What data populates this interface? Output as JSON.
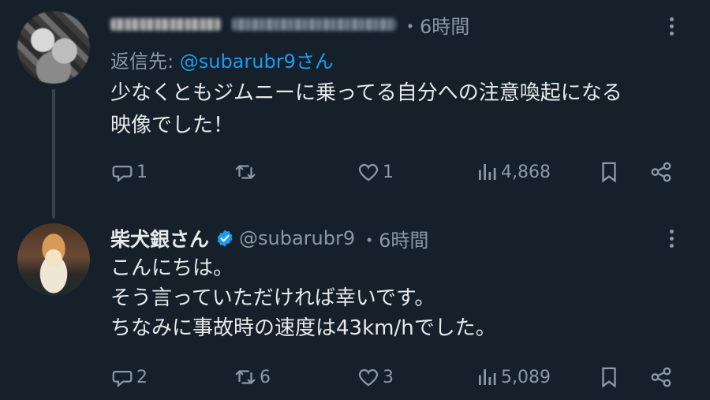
{
  "tweets": [
    {
      "author_name": "",
      "author_handle": "",
      "time": "・6時間",
      "reply_to_label": "返信先:",
      "reply_to_handle": "@subarubr9さん",
      "text_lines": [
        "少なくともジムニーに乗ってる自分への注意喚起になる",
        "映像でした！"
      ],
      "stats": {
        "replies": "1",
        "retweets": "",
        "likes": "1",
        "views": "4,868"
      }
    },
    {
      "author_name": "柴犬銀さん",
      "author_handle": "@subarubr9",
      "time": "・6時間",
      "verified": true,
      "text_lines": [
        "こんにちは。",
        "そう言っていただければ幸いです。",
        "ちなみに事故時の速度は43km/hでした。"
      ],
      "stats": {
        "replies": "2",
        "retweets": "6",
        "likes": "3",
        "views": "5,089"
      }
    }
  ],
  "icons": [
    "more-icon",
    "reply-icon",
    "retweet-icon",
    "like-icon",
    "views-icon",
    "bookmark-icon",
    "share-icon",
    "verified-icon"
  ],
  "colors": {
    "background": "#15202b",
    "text": "#e7e9ea",
    "muted": "#8b98a5",
    "link": "#1d9bf0",
    "verified": "#1d9bf0"
  }
}
